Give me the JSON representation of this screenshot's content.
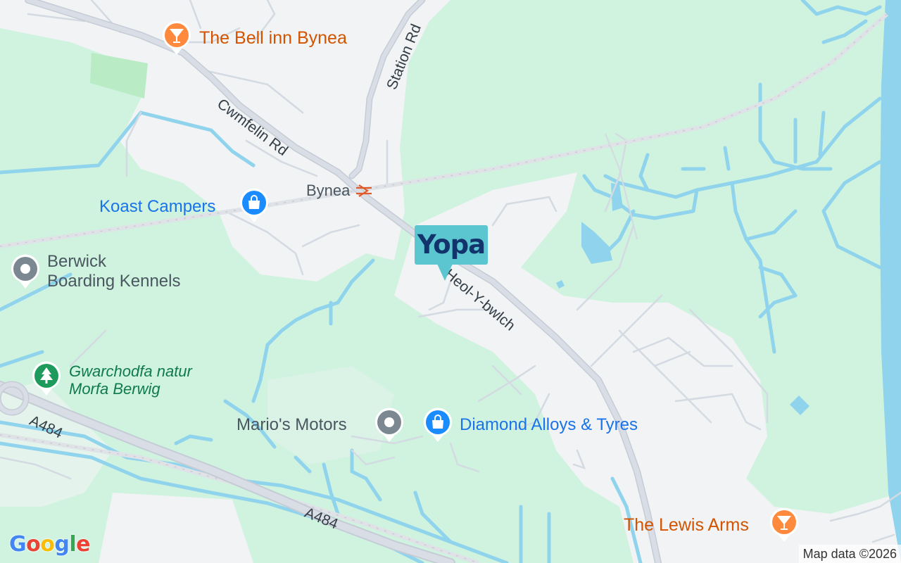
{
  "map": {
    "colors": {
      "land": "#cff3df",
      "urban": "#f1f3f4",
      "water": "#8fd3ec",
      "road": "#d7dce3",
      "park": "#b9ecc5"
    }
  },
  "labels": {
    "bell_inn": "The Bell inn Bynea",
    "station_rd": "Station Rd",
    "cwmfelin_rd": "Cwmfelin Rd",
    "bynea": "Bynea",
    "koast_campers": "Koast Campers",
    "berwick_line1": "Berwick",
    "berwick_line2": "Boarding Kennels",
    "heol_y_bwlch": "Heol-Y-bwlch",
    "gwarchodfa_line1": "Gwarchodfa natur",
    "gwarchodfa_line2": "Morfa Berwig",
    "a484_left": "A484",
    "a484_bottom": "A484",
    "marios": "Mario's Motors",
    "diamond": "Diamond Alloys & Tyres",
    "lewis_arms": "The Lewis Arms"
  },
  "marker": {
    "logo_text": "Yopa"
  },
  "icons": {
    "bar": "cocktail-glass-icon",
    "shop": "shopping-bag-icon",
    "generic": "place-dot-icon",
    "park": "tree-icon",
    "rail": "rail-icon"
  },
  "branding": {
    "google": "Google",
    "attribution": "Map data ©2026"
  }
}
